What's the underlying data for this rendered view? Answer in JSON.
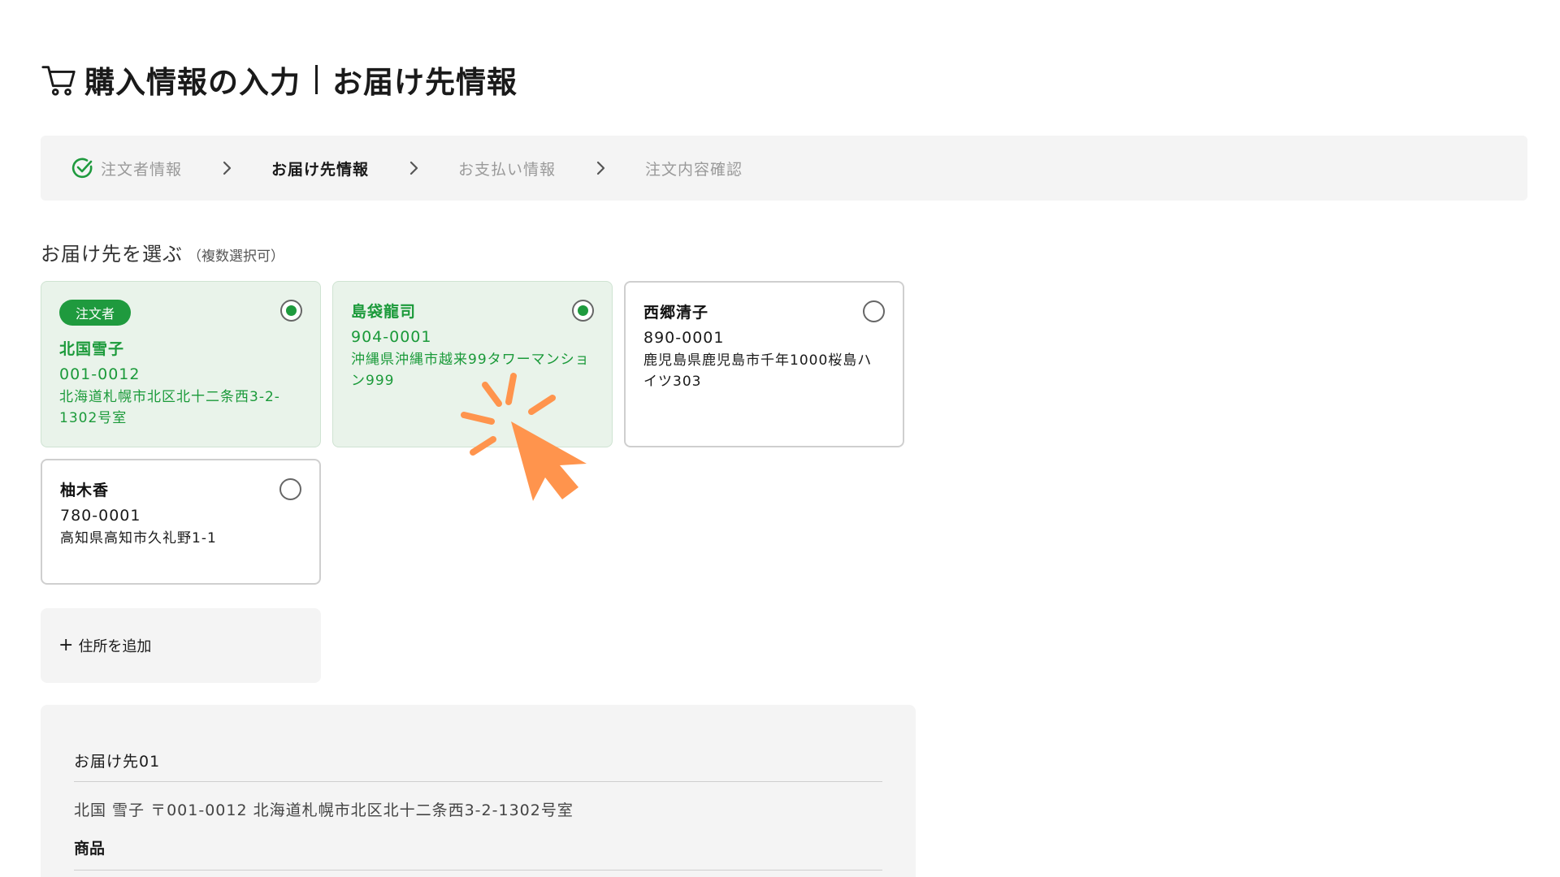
{
  "page": {
    "title_main": "購入情報の入力",
    "title_sub": "お届け先情報",
    "icon": "cart-icon"
  },
  "stepper": {
    "steps": [
      {
        "label": "注文者情報",
        "state": "done"
      },
      {
        "label": "お届け先情報",
        "state": "active"
      },
      {
        "label": "お支払い情報",
        "state": "upcoming"
      },
      {
        "label": "注文内容確認",
        "state": "upcoming"
      }
    ],
    "done_color": "#1f9a3e"
  },
  "section": {
    "heading": "お届け先を選ぶ",
    "note": "（複数選択可）"
  },
  "addresses": [
    {
      "badge": "注文者",
      "name": "北国雪子",
      "zip": "001-0012",
      "address": "北海道札幌市北区北十二条西3-2-1302号室",
      "selected": true
    },
    {
      "badge": "",
      "name": "島袋龍司",
      "zip": "904-0001",
      "address": "沖縄県沖縄市越来99タワーマンション999",
      "selected": true
    },
    {
      "badge": "",
      "name": "西郷清子",
      "zip": "890-0001",
      "address": "鹿児島県鹿児島市千年1000桜島ハイツ303",
      "selected": false
    },
    {
      "badge": "",
      "name": "柚木香",
      "zip": "780-0001",
      "address": "高知県高知市久礼野1-1",
      "selected": false
    }
  ],
  "add_address": {
    "label": "住所を追加",
    "plus": "+"
  },
  "summary": {
    "heading": "お届け先01",
    "address_line": "北国 雪子 〒001-0012 北海道札幌市北区北十二条西3-2-1302号室",
    "products_label": "商品"
  },
  "colors": {
    "accent": "#1f9a3e",
    "selected_bg": "#e9f3ea",
    "pointer": "#ff944d"
  }
}
